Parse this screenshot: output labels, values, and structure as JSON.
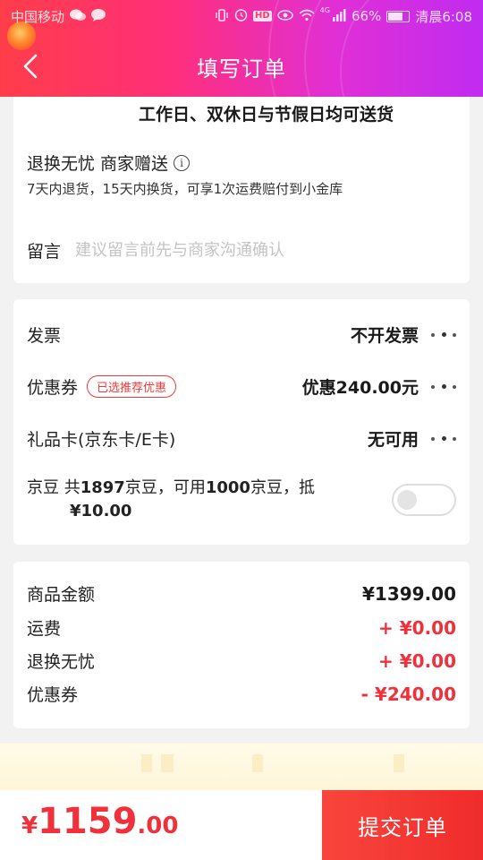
{
  "status_bar": {
    "carrier": "中国移动",
    "battery": "66%",
    "time": "清晨6:08",
    "left_icons": [
      "wechat-icon",
      "message-icon"
    ],
    "right_icons": [
      "vibrate-icon",
      "alarm-icon",
      "hd-icon",
      "eye-icon",
      "wifi-icon",
      "signal-icon"
    ],
    "network_label": "4G",
    "hd_label": "HD"
  },
  "nav": {
    "title": "填写订单"
  },
  "delivery": {
    "note": "工作日、双休日与节假日均可送货"
  },
  "service": {
    "title": "退换无忧",
    "gift": "商家赠送",
    "info_glyph": "i",
    "desc": "7天内退货，15天内换货，可享1次运费赔付到小金库"
  },
  "message": {
    "label": "留言",
    "placeholder": "建议留言前先与商家沟通确认"
  },
  "options": {
    "invoice": {
      "label": "发票",
      "value": "不开发票"
    },
    "coupon": {
      "label": "优惠券",
      "badge": "已选推荐优惠",
      "value": "优惠240.00元"
    },
    "giftcard": {
      "label": "礼品卡(京东卡/E卡)",
      "value": "无可用"
    },
    "jdbean": {
      "prefix": "京豆 共",
      "total": "1897",
      "mid": "京豆，可用",
      "usable": "1000",
      "suffix": "京豆，抵",
      "deduct": "¥10.00",
      "enabled": false
    }
  },
  "summary": [
    {
      "label": "商品金额",
      "value": "¥1399.00",
      "color": "#1a1a1a"
    },
    {
      "label": "运费",
      "value": "+ ¥0.00",
      "color": "#f0303a"
    },
    {
      "label": "退换无忧",
      "value": "+ ¥0.00",
      "color": "#f0303a"
    },
    {
      "label": "优惠券",
      "value": "- ¥240.00",
      "color": "#f0303a"
    }
  ],
  "footer": {
    "currency": "¥",
    "total_int": "1159",
    "total_dec": ".00",
    "submit_label": "提交订单"
  },
  "colors": {
    "accent": "#f0303a",
    "header_start": "#ff3d4a",
    "header_end": "#c02cf0"
  }
}
